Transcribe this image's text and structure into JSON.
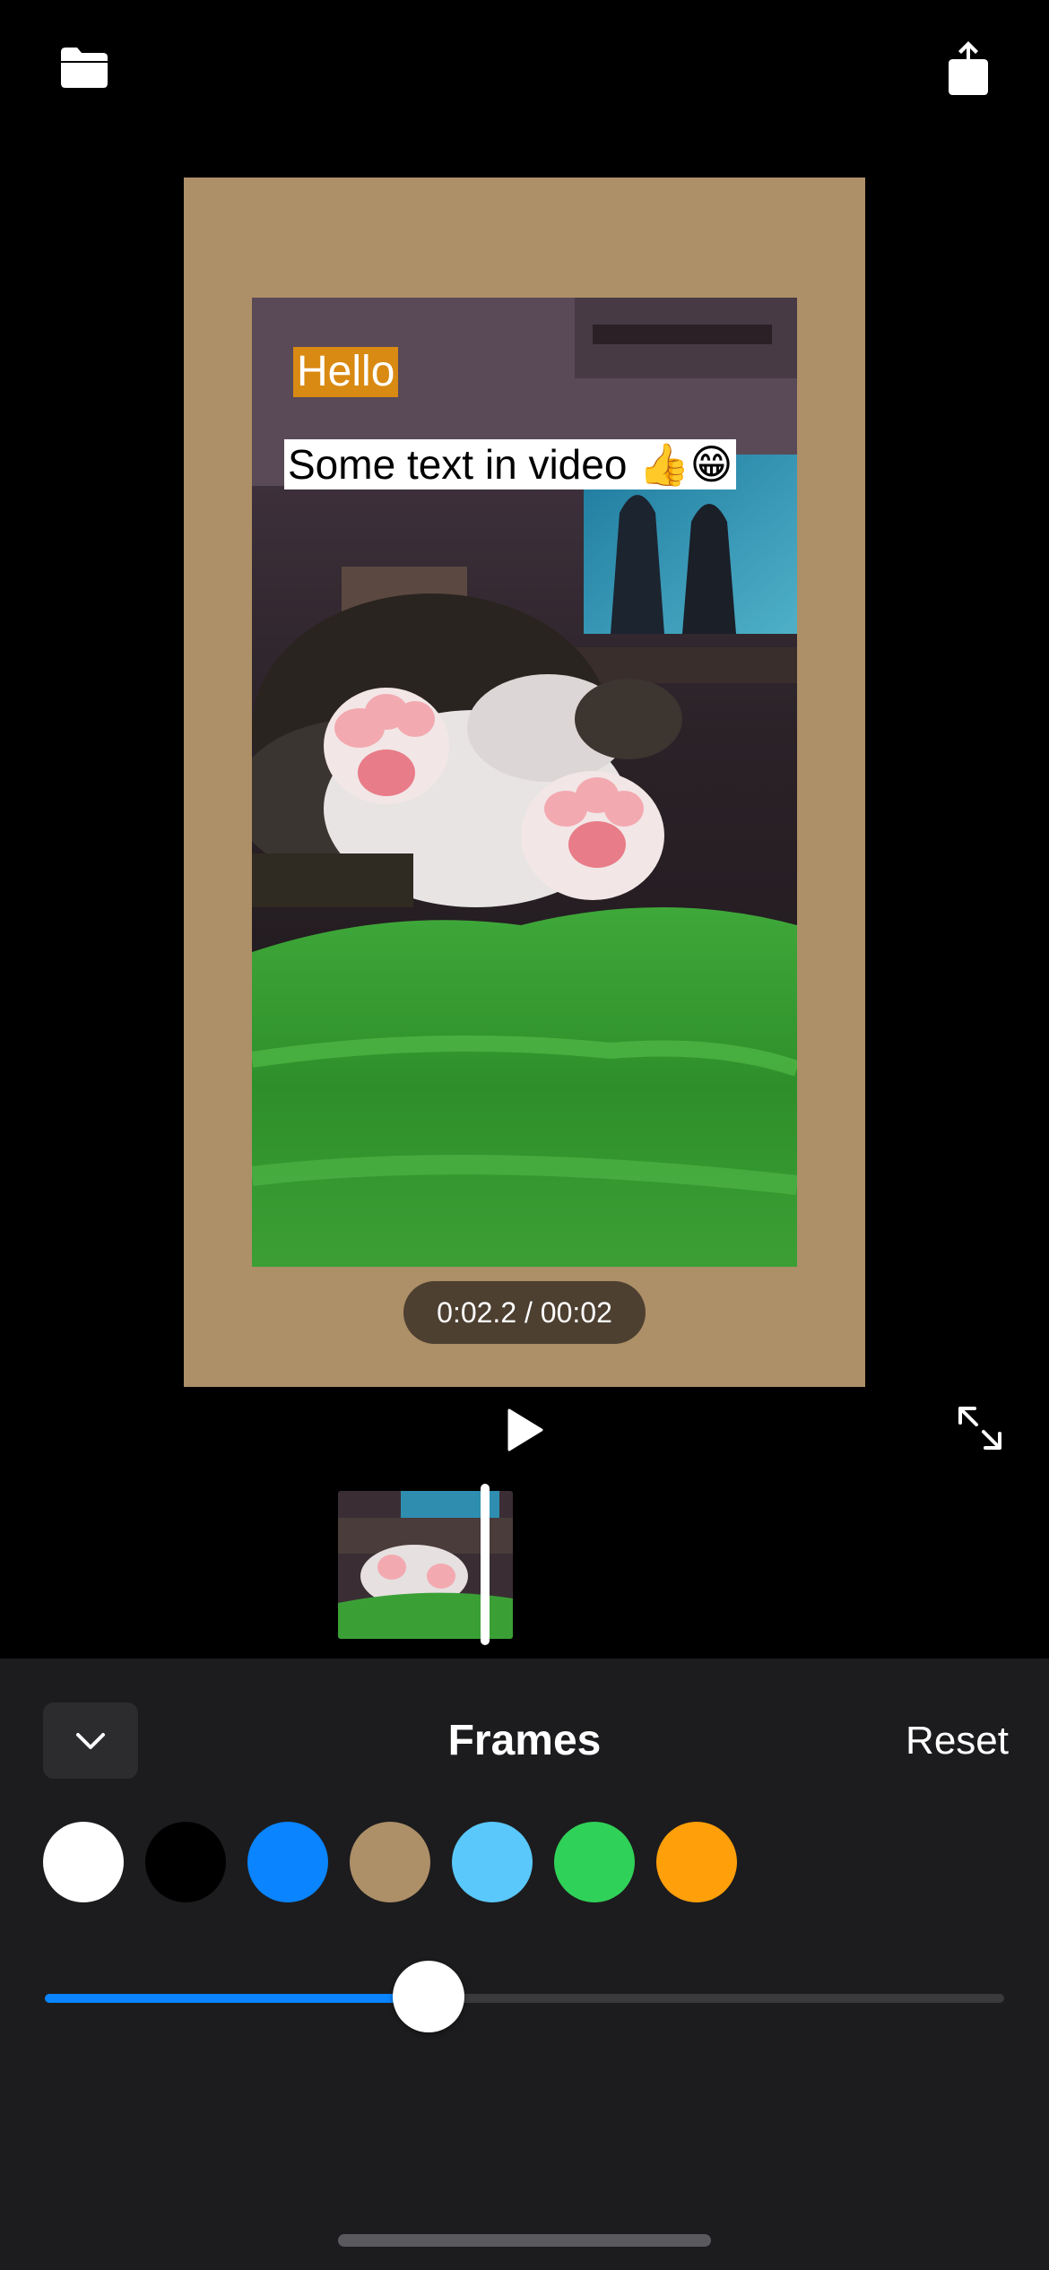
{
  "toolbar": {
    "open_icon": "folder-icon",
    "share_icon": "share-icon"
  },
  "preview": {
    "frame_color": "#AD8F68",
    "overlay_hello": "Hello",
    "overlay_hello_bg": "#D98A12",
    "overlay_text": "Some text in video 👍😁",
    "time_display": "0:02.2 / 00:02"
  },
  "controls": {
    "play_icon": "play-icon",
    "expand_icon": "expand-icon"
  },
  "panel": {
    "collapse_icon": "chevron-down-icon",
    "title": "Frames",
    "reset_label": "Reset",
    "colors": [
      "#FFFFFF",
      "#000000",
      "#0A84FF",
      "#AD8F68",
      "#5AC8FA",
      "#30D158",
      "#FF9F0A"
    ],
    "slider_value": 0.4
  }
}
